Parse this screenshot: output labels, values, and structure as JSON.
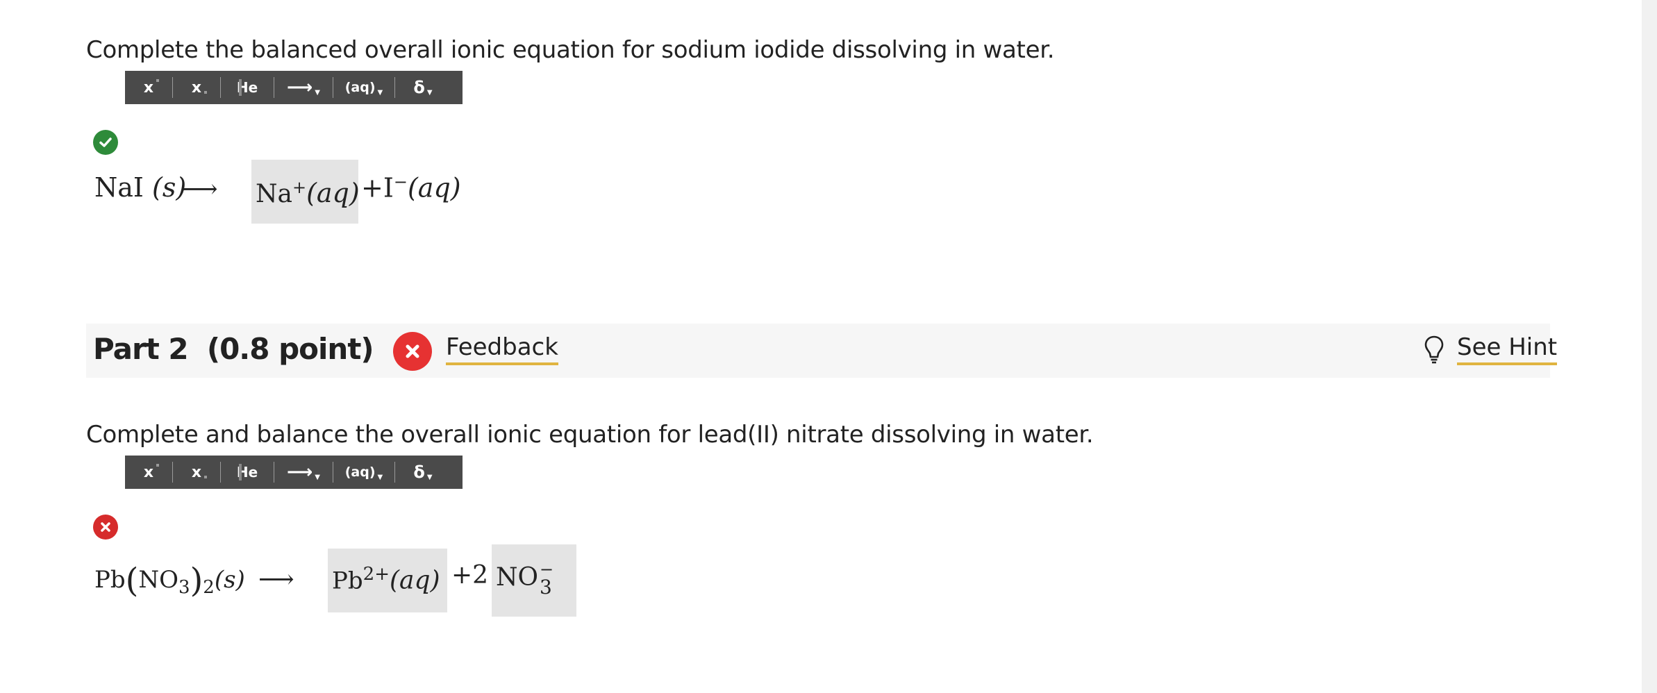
{
  "part1": {
    "question": "Complete the balanced overall ionic equation for sodium iodide dissolving in water.",
    "toolbar": {
      "superscript_label": "x",
      "subscript_label": "x",
      "element_label": "He",
      "arrow_label": "⟶",
      "aq_label": "(aq)",
      "delta_label": "δ"
    },
    "status": "correct",
    "equation": {
      "reactant": "NaI",
      "reactant_state": "(s)",
      "arrow": "⟶",
      "answer_ion": "Na",
      "answer_charge": "+",
      "answer_state": "(aq)",
      "plus": "+",
      "product2": "I",
      "product2_charge": "−",
      "product2_state": "(aq)"
    }
  },
  "part2": {
    "title": "Part 2",
    "points": "(0.8 point)",
    "feedback_label": "Feedback",
    "hint_label": "See Hint",
    "question": "Complete and balance the overall ionic equation for lead(II) nitrate dissolving in water.",
    "toolbar": {
      "superscript_label": "x",
      "subscript_label": "x",
      "element_label": "He",
      "arrow_label": "⟶",
      "aq_label": "(aq)",
      "delta_label": "δ"
    },
    "status": "incorrect",
    "equation": {
      "reactant_pb": "Pb",
      "reactant_paren_open": "(",
      "reactant_no": "NO",
      "reactant_no_sub": "3",
      "reactant_paren_close": ")",
      "reactant_outer_sub": "2",
      "reactant_state": "(s)",
      "arrow": "⟶",
      "answer_ion": "Pb",
      "answer_charge": "2+",
      "answer_state": "(aq)",
      "plus_coeff": "+2",
      "answer2_ion": "NO",
      "answer2_sub": "3",
      "answer2_charge": "−"
    }
  },
  "colors": {
    "correct": "#2e8b3a",
    "incorrect": "#d62b2b",
    "toolbar_bg": "#4a4a4a",
    "answer_box": "#e4e4e4",
    "link_underline": "#e0b440"
  }
}
